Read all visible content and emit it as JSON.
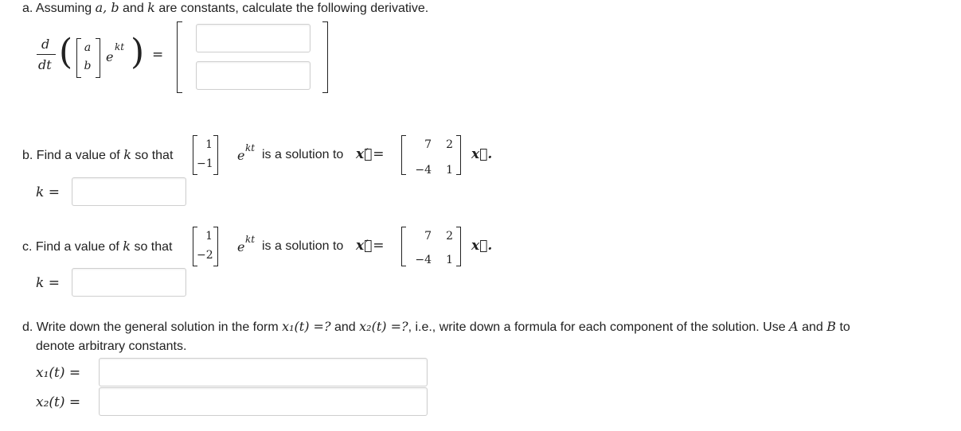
{
  "part_a": {
    "label": "a. Assuming",
    "vars": "a, b",
    "and": "and",
    "k": "k",
    "rest": "are constants, calculate the following derivative.",
    "d": "d",
    "dt": "dt",
    "vec_top": "a",
    "vec_bottom": "b",
    "exp_base": "e",
    "exponent": "kt",
    "equals": "=",
    "input_top": "",
    "input_bottom": ""
  },
  "part_b": {
    "label": "b. Find a value of",
    "k": "k",
    "so_that": "so that",
    "vec_top": "1",
    "vec_bottom": "−1",
    "exp_base": "e",
    "exponent": "kt",
    "is_solution": "is a solution to",
    "xvec": "x⃗",
    "prime_eq": "′ =",
    "matrix": [
      [
        "7",
        "2"
      ],
      [
        "−4",
        "1"
      ]
    ],
    "tail": "x⃗.",
    "answer_label": "k =",
    "answer_value": ""
  },
  "part_c": {
    "label": "c. Find a value of",
    "k": "k",
    "so_that": "so that",
    "vec_top": "1",
    "vec_bottom": "−2",
    "exp_base": "e",
    "exponent": "kt",
    "is_solution": "is a solution to",
    "xvec": "x⃗",
    "prime_eq": "′ =",
    "matrix": [
      [
        "7",
        "2"
      ],
      [
        "−4",
        "1"
      ]
    ],
    "tail": "x⃗.",
    "answer_label": "k =",
    "answer_value": ""
  },
  "part_d": {
    "line1_start": "d. Write down the general solution in the form",
    "x1": "x₁(t) =?",
    "and": "and",
    "x2": "x₂(t) =?",
    "line1_end": ", i.e., write down a formula for each component of the solution. Use",
    "A": "A",
    "and2": "and",
    "B": "B",
    "to": "to",
    "line2": "denote arbitrary constants.",
    "x1_label": "x₁(t) =",
    "x2_label": "x₂(t) =",
    "x1_value": "",
    "x2_value": ""
  }
}
